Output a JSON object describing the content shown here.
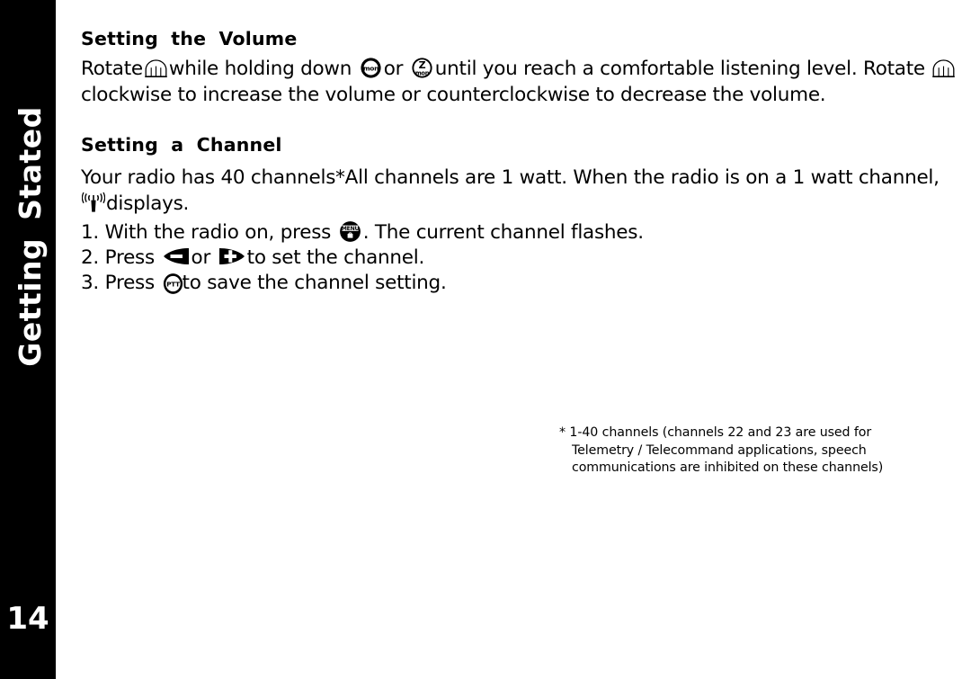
{
  "page": {
    "number": "14",
    "tab_label": "Getting  Stated"
  },
  "sections": [
    {
      "id": "volume",
      "heading": "Setting  the  Volume",
      "paragraph_parts": {
        "p1": "Rotate",
        "p2": "while holding down",
        "p3": "or",
        "p4": "until you reach a comfortable listening level. Rotate",
        "p5": "clockwise to increase the volume or counterclockwise to decrease the volume."
      },
      "icons": {
        "knob": "volume-knob-icon",
        "mon": "mon-button-icon",
        "zmon": "z-mon-button-icon"
      }
    },
    {
      "id": "channel",
      "heading": "Setting  a  Channel",
      "paragraph_parts": {
        "p1": "Your radio has 40 channels*All channels are 1 watt. When the radio is on a 1 watt channel,",
        "p2": "displays."
      },
      "icons": {
        "transmit": "radio-transmit-icon"
      },
      "steps": [
        {
          "number": "1.",
          "text_before": "With the radio on, press",
          "icon": "menu-button-icon",
          "text_after": ". The current channel flashes."
        },
        {
          "number": "2.",
          "text_before": "Press",
          "icon": "minus-key-icon",
          "text_middle": "or",
          "icon2": "plus-key-icon",
          "text_after": "to set the channel."
        },
        {
          "number": "3.",
          "text_before": "Press",
          "icon": "ptt-button-icon",
          "text_after": "to save the channel setting."
        }
      ]
    }
  ],
  "footnote": {
    "marker": "*",
    "text": "1-40 channels (channels 22 and 23 are used for Telemetry / Telecommand applications, speech communications are inhibited on these channels)"
  },
  "button_labels": {
    "mon": "mon",
    "zmon_top": "Z",
    "zmon_bottom": "mon",
    "menu": "MENU",
    "ptt": "PTT",
    "minus": "–",
    "plus": "+"
  },
  "colors": {
    "sidebar_background": "#000000",
    "page_background": "#ffffff",
    "text": "#000000",
    "sidebar_text": "#ffffff"
  }
}
